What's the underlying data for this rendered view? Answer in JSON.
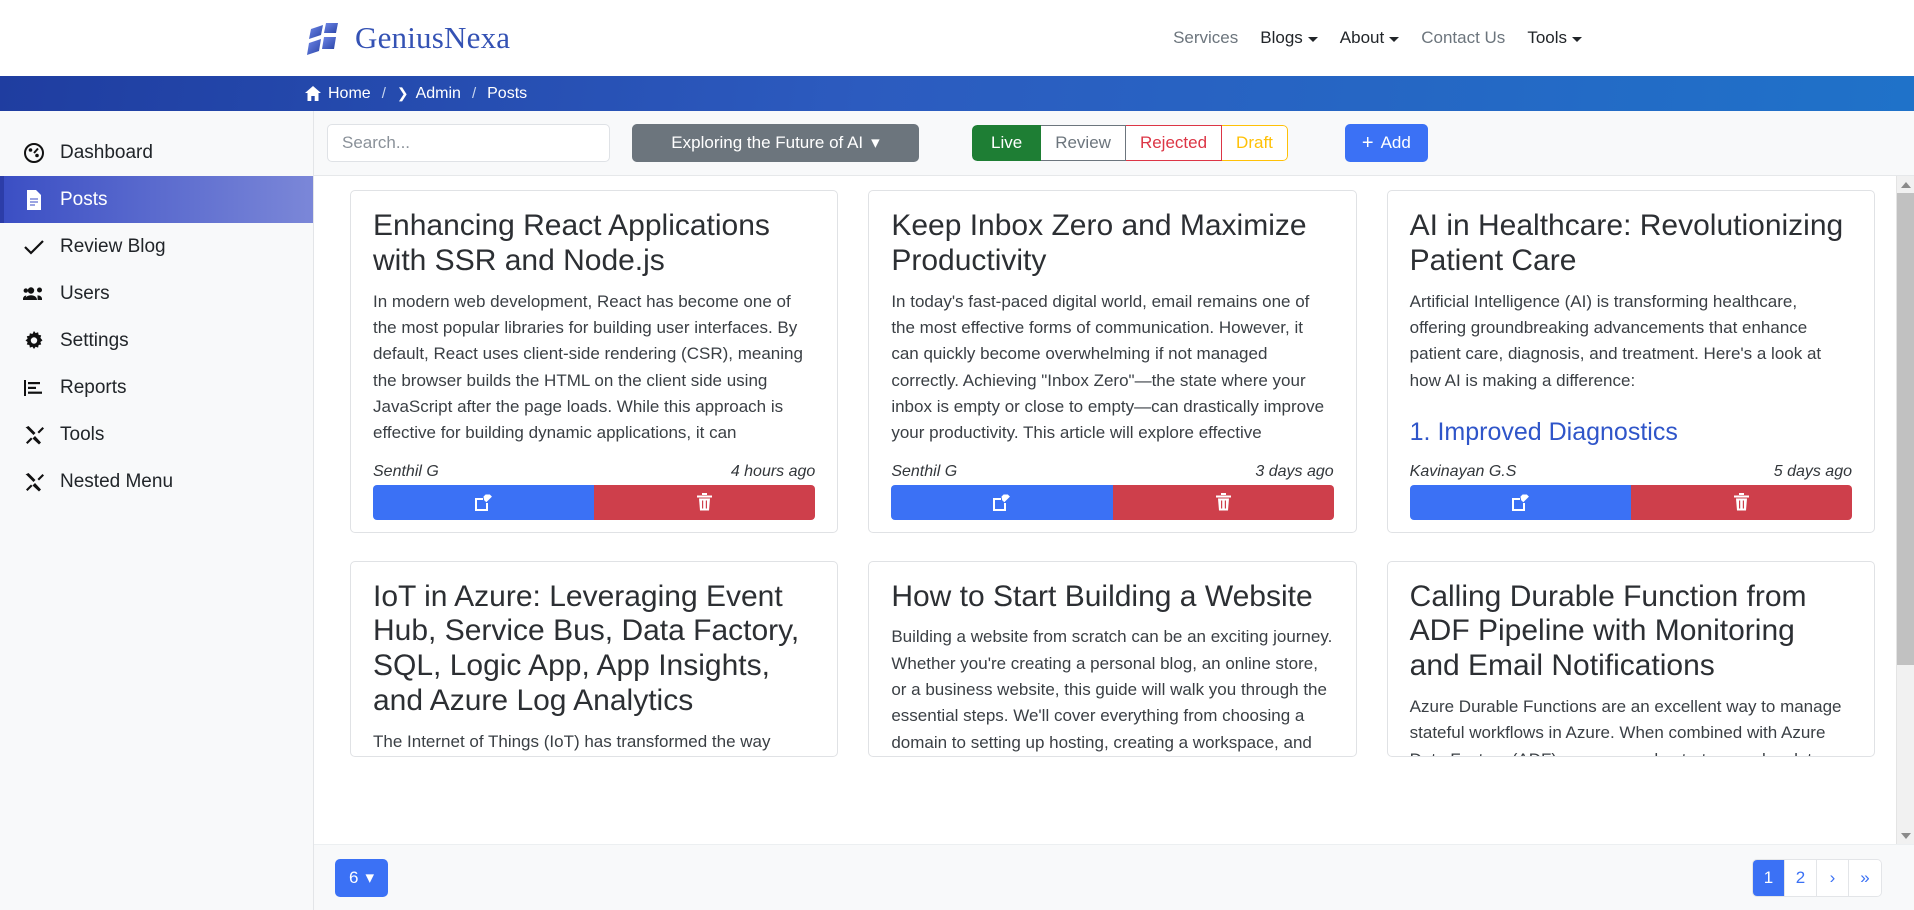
{
  "brand": {
    "name": "GeniusNexa",
    "logo_icon": "geniusnexa-logo-icon"
  },
  "mainnav": [
    {
      "label": "Services",
      "has_caret": false,
      "emphasis": "muted"
    },
    {
      "label": "Blogs",
      "has_caret": true,
      "emphasis": "dark"
    },
    {
      "label": "About",
      "has_caret": true,
      "emphasis": "dark"
    },
    {
      "label": "Contact Us",
      "has_caret": false,
      "emphasis": "muted"
    },
    {
      "label": "Tools",
      "has_caret": true,
      "emphasis": "dark"
    }
  ],
  "breadcrumb": {
    "home_icon": "home-icon",
    "items": [
      "Home",
      "Admin",
      "Posts"
    ],
    "separator": "/",
    "chevron": "❯"
  },
  "sidebar": {
    "items": [
      {
        "label": "Dashboard",
        "icon": "dashboard-icon",
        "active": false
      },
      {
        "label": "Posts",
        "icon": "document-icon",
        "active": true
      },
      {
        "label": "Review Blog",
        "icon": "check-icon",
        "active": false
      },
      {
        "label": "Users",
        "icon": "users-icon",
        "active": false
      },
      {
        "label": "Settings",
        "icon": "gear-icon",
        "active": false
      },
      {
        "label": "Reports",
        "icon": "report-chart-icon",
        "active": false
      },
      {
        "label": "Tools",
        "icon": "tools-icon",
        "active": false
      },
      {
        "label": "Nested Menu",
        "icon": "tools-icon",
        "active": false
      }
    ]
  },
  "toolbar": {
    "search_placeholder": "Search...",
    "search_value": "",
    "category_dropdown": {
      "label": "Exploring the Future of AI",
      "caret": "▾"
    },
    "filters": [
      {
        "label": "Live",
        "state": "active",
        "color": "#1e7e34"
      },
      {
        "label": "Review",
        "state": "inactive",
        "color": "#6c757d"
      },
      {
        "label": "Rejected",
        "state": "inactive",
        "color": "#dc3545"
      },
      {
        "label": "Draft",
        "state": "inactive",
        "color": "#ffc107"
      }
    ],
    "add_button": {
      "label": "Add",
      "icon": "plus-icon"
    }
  },
  "cards": [
    {
      "title": "Enhancing React Applications with SSR and Node.js",
      "excerpt": "In modern web development, React has become one of the most popular libraries for building user interfaces. By default, React uses client-side rendering (CSR), meaning the browser builds the HTML on the client side using JavaScript after the page loads. While this approach is effective for building dynamic applications, it can",
      "subheading": "",
      "author": "Senthil G",
      "time": "4 hours ago",
      "edit_icon": "edit-pencil-icon",
      "delete_icon": "trash-icon"
    },
    {
      "title": "Keep Inbox Zero and Maximize Productivity",
      "excerpt": "In today's fast-paced digital world, email remains one of the most effective forms of communication. However, it can quickly become overwhelming if not managed correctly. Achieving \"Inbox Zero\"—the state where your inbox is empty or close to empty—can drastically improve your productivity. This article will explore effective",
      "subheading": "",
      "author": "Senthil G",
      "time": "3 days ago",
      "edit_icon": "edit-pencil-icon",
      "delete_icon": "trash-icon"
    },
    {
      "title": "AI in Healthcare: Revolutionizing Patient Care",
      "excerpt": "Artificial Intelligence (AI) is transforming healthcare, offering groundbreaking advancements that enhance patient care, diagnosis, and treatment. Here's a look at how AI is making a difference:",
      "subheading": "1. Improved Diagnostics",
      "author": "Kavinayan G.S",
      "time": "5 days ago",
      "edit_icon": "edit-pencil-icon",
      "delete_icon": "trash-icon"
    },
    {
      "title": "IoT in Azure: Leveraging Event Hub, Service Bus, Data Factory, SQL, Logic App, App Insights, and Azure Log Analytics",
      "excerpt": "The Internet of Things (IoT) has transformed the way businesses operate, providing real-time insights and",
      "subheading": "",
      "author": "",
      "time": "",
      "edit_icon": "edit-pencil-icon",
      "delete_icon": "trash-icon"
    },
    {
      "title": "How to Start Building a Website",
      "excerpt": "Building a website from scratch can be an exciting journey. Whether you're creating a personal blog, an online store, or a business website, this guide will walk you through the essential steps. We'll cover everything from choosing a domain to setting up hosting, creating a workspace, and more. Let's get started!",
      "subheading": "",
      "author": "",
      "time": "",
      "edit_icon": "edit-pencil-icon",
      "delete_icon": "trash-icon"
    },
    {
      "title": "Calling Durable Function from ADF Pipeline with Monitoring and Email Notifications",
      "excerpt": "Azure Durable Functions are an excellent way to manage stateful workflows in Azure. When combined with Azure Data Factory (ADF), you can orchestrate complex data processing pipelines with ease. In this article, we'll",
      "subheading": "",
      "author": "",
      "time": "",
      "edit_icon": "edit-pencil-icon",
      "delete_icon": "trash-icon"
    }
  ],
  "footer": {
    "page_size": {
      "value": "6",
      "caret": "▾"
    },
    "pagination": [
      {
        "label": "1",
        "active": true
      },
      {
        "label": "2",
        "active": false
      },
      {
        "label": "›",
        "active": false
      },
      {
        "label": "»",
        "active": false
      }
    ]
  },
  "colors": {
    "primary_blue": "#3b71f5",
    "sidebar_active_from": "#3b4fc4",
    "sidebar_active_to": "#7b87d8",
    "danger_red": "#ce3f4b",
    "success_green": "#1e7e34",
    "warning_yellow": "#ffc107",
    "brand_blue": "#3452b4",
    "card_subheading_blue": "#2f55c9"
  }
}
